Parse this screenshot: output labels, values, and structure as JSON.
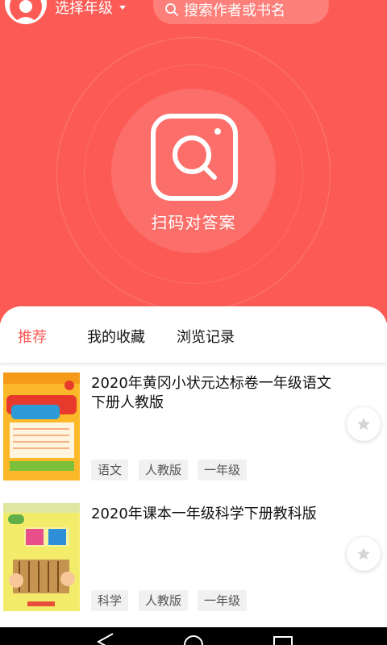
{
  "header": {
    "grade_label": "选择年级",
    "search_placeholder": "搜索作者或书名",
    "scan_label": "扫码对答案",
    "accent_color": "#fc5b55"
  },
  "tabs": [
    {
      "label": "推荐",
      "active": true
    },
    {
      "label": "我的收藏",
      "active": false
    },
    {
      "label": "浏览记录",
      "active": false
    }
  ],
  "books": [
    {
      "title": "2020年黄冈小状元达标卷一年级语文下册人教版",
      "cover_icon": "dabiaojuan-cover-illustration",
      "tags": [
        "语文",
        "人教版",
        "一年级"
      ]
    },
    {
      "title": "2020年课本一年级科学下册教科版",
      "cover_icon": "textbook-math-cover-illustration",
      "tags": [
        "科学",
        "人教版",
        "一年级"
      ]
    }
  ],
  "icons": {
    "avatar": "user-avatar-icon",
    "search": "search-icon",
    "scan": "scan-qr-icon",
    "favorite": "star-icon"
  }
}
